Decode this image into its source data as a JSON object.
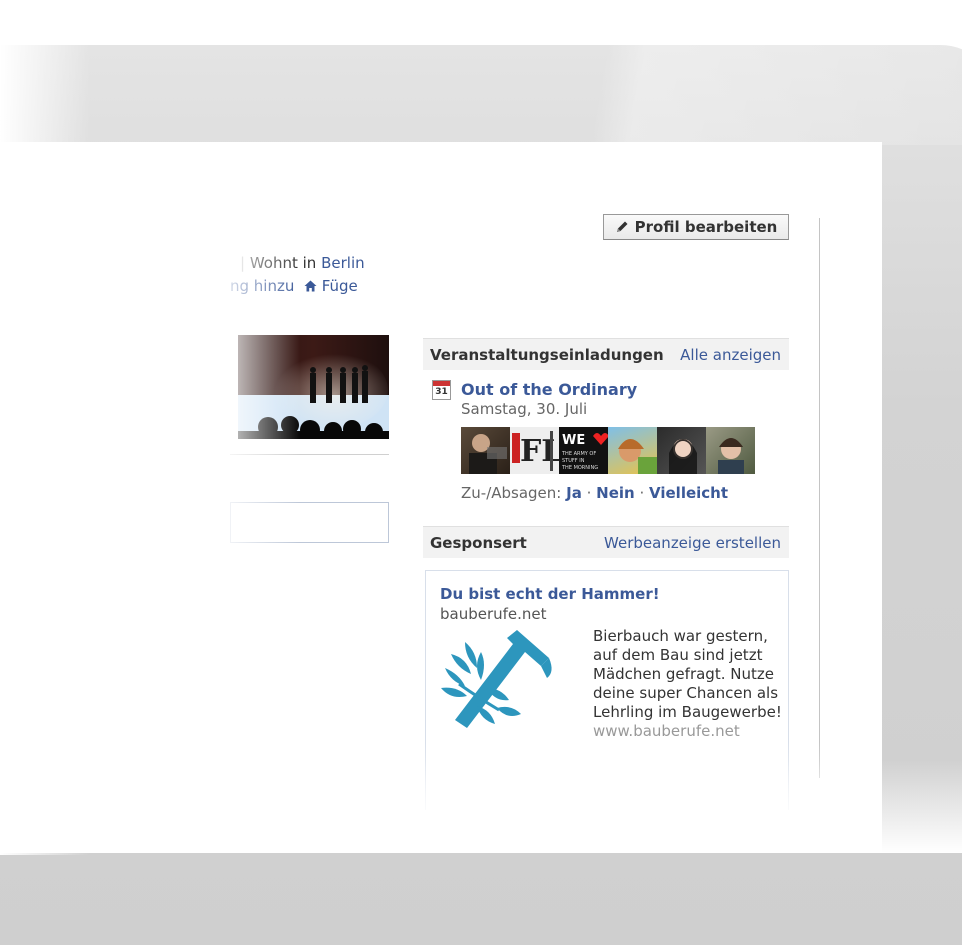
{
  "profile": {
    "edit_button_label": "Profil bearbeiten",
    "info_line_prefix": "Wohnt in ",
    "info_city": "Berlin",
    "info_link_partial": "ng hinzu",
    "info_link_add": "Füge"
  },
  "events": {
    "header_title": "Veranstaltungseinladungen",
    "header_action": "Alle anzeigen",
    "calendar_day": "31",
    "event_title": "Out of the Ordinary",
    "event_date": "Samstag, 30. Juli",
    "rsvp_label": "Zu-/Absagen: ",
    "rsvp_yes": "Ja",
    "rsvp_no": "Nein",
    "rsvp_maybe": "Vielleicht",
    "separator": " · "
  },
  "sponsored": {
    "header_title": "Gesponsert",
    "header_action": "Werbeanzeige erstellen",
    "ad_title": "Du bist echt der Hammer!",
    "ad_domain": "bauberufe.net",
    "ad_body": "Bierbauch war gestern, auf dem Bau sind jetzt Mädchen gefragt. Nutze deine super Chancen als Lehrling im Baugewerbe!",
    "ad_url": "www.bauberufe.net"
  },
  "colors": {
    "link_blue": "#3b5998",
    "ad_icon_teal": "#2d96bd"
  },
  "icons": [
    "pencil-icon",
    "home-icon",
    "calendar-icon",
    "hammer-logo-icon"
  ]
}
